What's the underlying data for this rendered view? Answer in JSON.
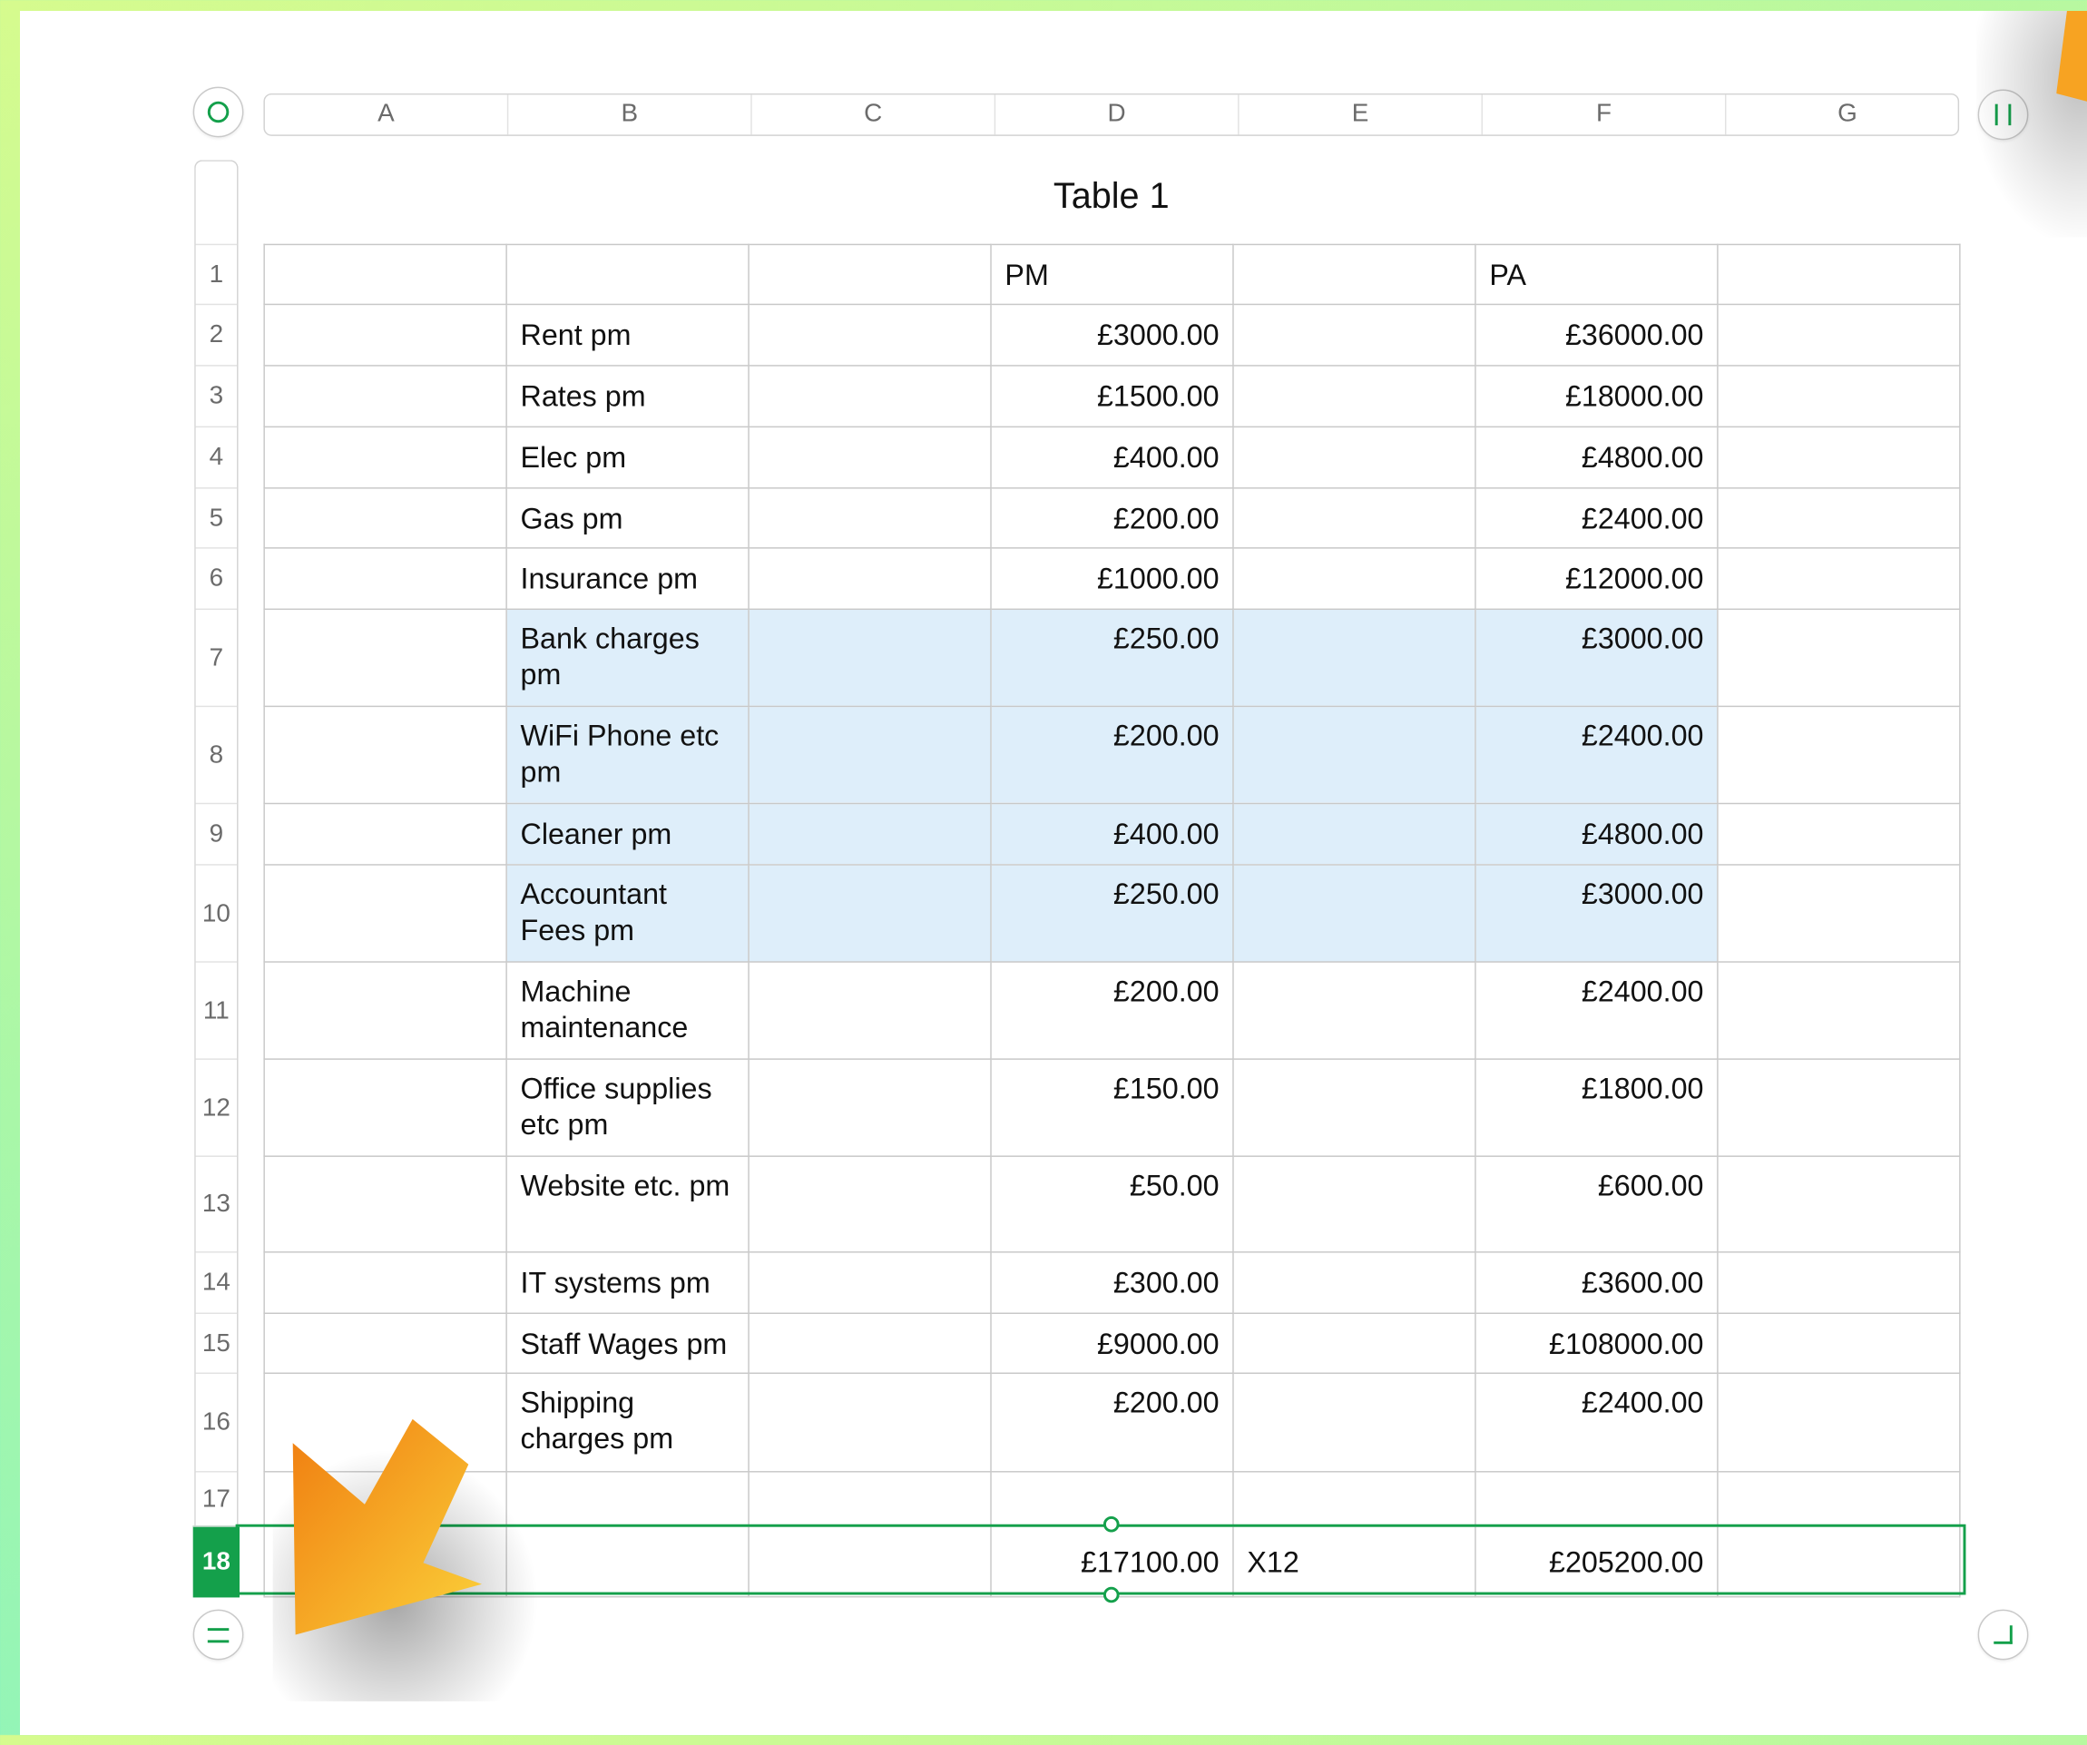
{
  "table_title": "Table 1",
  "columns": [
    "A",
    "B",
    "C",
    "D",
    "E",
    "F",
    "G"
  ],
  "row_numbers": [
    "1",
    "2",
    "3",
    "4",
    "5",
    "6",
    "7",
    "8",
    "9",
    "10",
    "11",
    "12",
    "13",
    "14",
    "15",
    "16",
    "17",
    "18"
  ],
  "selected_row": "18",
  "header_row": {
    "d": "PM",
    "f": "PA"
  },
  "rows": [
    {
      "label": "Rent pm",
      "pm": "£3000.00",
      "pa": "£36000.00"
    },
    {
      "label": "Rates pm",
      "pm": "£1500.00",
      "pa": "£18000.00"
    },
    {
      "label": "Elec pm",
      "pm": "£400.00",
      "pa": "£4800.00"
    },
    {
      "label": "Gas pm",
      "pm": "£200.00",
      "pa": "£2400.00"
    },
    {
      "label": "Insurance pm",
      "pm": "£1000.00",
      "pa": "£12000.00"
    },
    {
      "label": "Bank charges pm",
      "pm": "£250.00",
      "pa": "£3000.00"
    },
    {
      "label": "WiFi Phone etc pm",
      "pm": "£200.00",
      "pa": "£2400.00"
    },
    {
      "label": "Cleaner pm",
      "pm": "£400.00",
      "pa": "£4800.00"
    },
    {
      "label": "Accountant Fees pm",
      "pm": "£250.00",
      "pa": "£3000.00"
    },
    {
      "label": "Machine maintenance",
      "pm": "£200.00",
      "pa": "£2400.00"
    },
    {
      "label": "Office supplies etc pm",
      "pm": "£150.00",
      "pa": "£1800.00"
    },
    {
      "label": "Website etc. pm",
      "pm": "£50.00",
      "pa": "£600.00"
    },
    {
      "label": "IT systems pm",
      "pm": "£300.00",
      "pa": "£3600.00"
    },
    {
      "label": "Staff Wages pm",
      "pm": "£9000.00",
      "pa": "£108000.00"
    },
    {
      "label": "Shipping charges pm",
      "pm": "£200.00",
      "pa": "£2400.00"
    }
  ],
  "total_row": {
    "pm": "£17100.00",
    "multiplier": "X12",
    "pa": "£205200.00"
  },
  "colors": {
    "accent": "#14a04b",
    "highlight": "#deeefa",
    "arrow_start": "#f07d10",
    "arrow_end": "#fbd23a"
  },
  "icons": {
    "top_left": "circle-icon",
    "top_right": "pause-bars-icon",
    "bottom_left": "equals-icon",
    "bottom_right": "resize-corner-icon",
    "pointer": "pointer-arrow-icon"
  }
}
